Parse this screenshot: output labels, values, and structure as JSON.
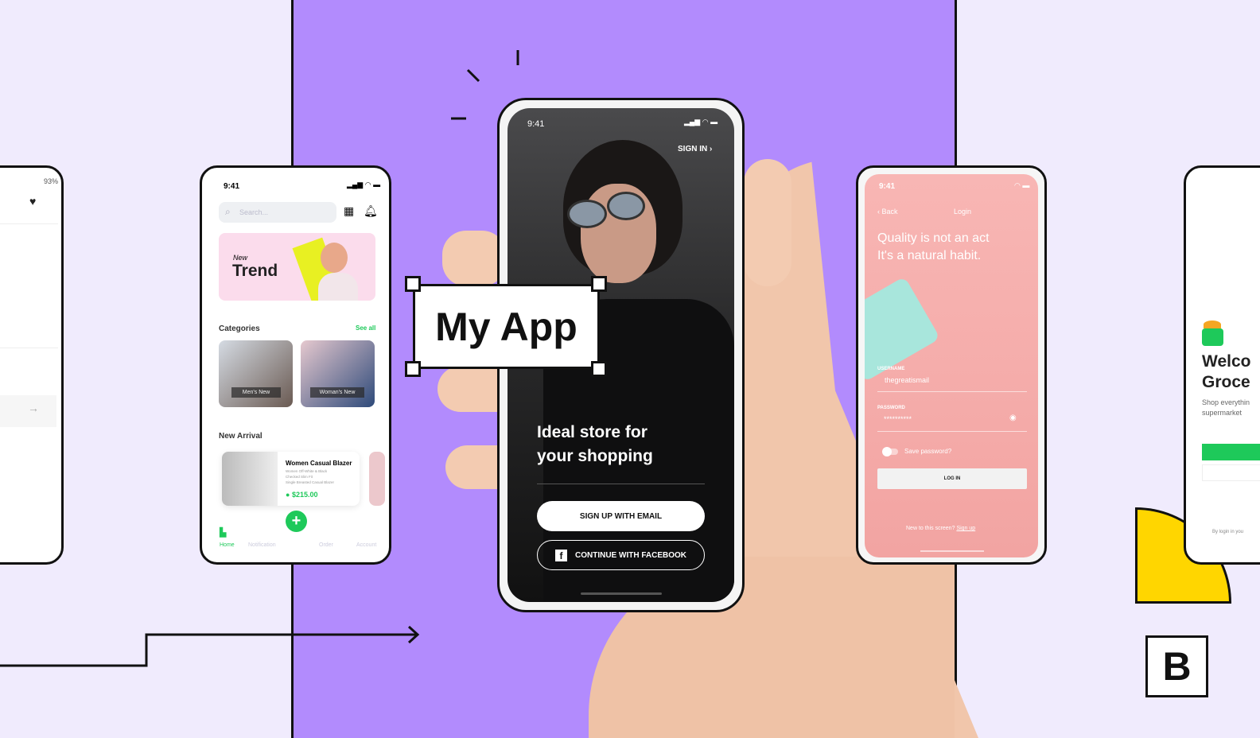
{
  "colors": {
    "background": "#f0ebfd",
    "panel": "#b28bfd",
    "accent_green": "#1ec95a",
    "login_pink": "#f5a8a6",
    "yellow": "#ffd600"
  },
  "label": {
    "title": "My App"
  },
  "left_phone": {
    "battery": "93%",
    "icon": "heart-icon"
  },
  "shop_phone": {
    "time": "9:41",
    "search_placeholder": "Search...",
    "banner": {
      "small": "New",
      "big": "Trend"
    },
    "categories_title": "Categories",
    "see_all": "See all",
    "categories": [
      "Men's New",
      "Woman's New"
    ],
    "new_arrival_title": "New Arrival",
    "product": {
      "name": "Women Casual Blazer",
      "desc1": "Women Off-White & Black",
      "desc2": "Checked Slim Fit",
      "desc3": "Single Breasted Casual Blazer",
      "price": "$215.00"
    },
    "nav": [
      "Home",
      "Notification",
      "Order",
      "Account"
    ]
  },
  "center_phone": {
    "time": "9:41",
    "sign_in": "SIGN IN",
    "headline1": "Ideal store for",
    "headline2": "your shopping",
    "signup_email": "SIGN UP WITH EMAIL",
    "facebook": "CONTINUE WITH FACEBOOK"
  },
  "login_phone": {
    "time": "9:41",
    "back": "Back",
    "title": "Login",
    "quote1": "Quality is not an act",
    "quote2": "It's a natural habit.",
    "username_label": "USERNAME",
    "username_value": "thegreatismail",
    "password_label": "PASSWORD",
    "password_value": "**********",
    "save_password": "Save password?",
    "login_button": "LOG IN",
    "new_user": "New to this screen?",
    "sign_up": "Sign up"
  },
  "grocery_phone": {
    "welcome1": "Welco",
    "welcome2": "Groce",
    "sub1": "Shop everythin",
    "sub2": "supermarket",
    "terms": "By login in you"
  },
  "brand": {
    "logo": "B"
  }
}
